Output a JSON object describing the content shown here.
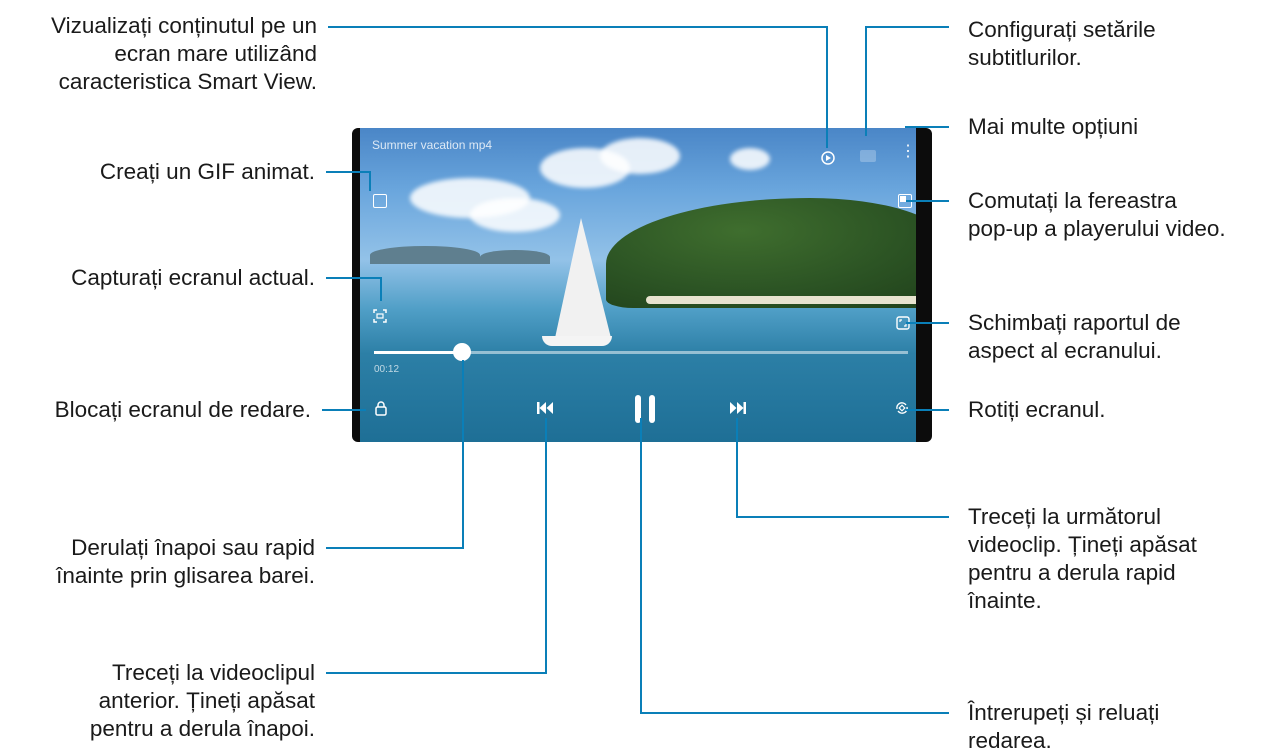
{
  "video": {
    "title": "Summer vacation mp4",
    "timecode": "00:12"
  },
  "playback": {
    "progress": 0.18
  },
  "callouts": {
    "smart_view": "Vizualizați conținutul pe un\necran mare utilizând\ncaracteristica Smart View.",
    "subtitles": "Configurați setările\nsubtitlurilor.",
    "more_options": "Mai multe opțiuni",
    "gif": "Creați un GIF animat.",
    "popup": "Comutați la fereastra\npop-up a playerului video.",
    "capture": "Capturați ecranul actual.",
    "aspect": "Schimbați raportul de\naspect al ecranului.",
    "lock": "Blocați ecranul de redare.",
    "rotate": "Rotiți ecranul.",
    "seek": "Derulați înapoi sau rapid\nînainte prin glisarea barei.",
    "next": "Treceți la următorul\nvideoclip. Țineți apăsat\npentru a derula rapid\nînainte.",
    "previous": "Treceți la videoclipul\nanterior. Țineți apăsat\npentru a derula înapoi.",
    "pause": "Întrerupeți și reluați\nredarea."
  },
  "icons": {
    "smart_view": "smart-view-icon",
    "subtitles": "subtitles-icon",
    "more": "more-vertical-icon",
    "gif": "gif-icon",
    "popup": "popup-player-icon",
    "capture": "capture-icon",
    "aspect": "aspect-ratio-icon",
    "lock": "lock-icon",
    "rotate": "rotate-icon",
    "previous": "skip-previous-icon",
    "pause": "pause-icon",
    "next": "skip-next-icon"
  },
  "colors": {
    "leader_line": "#0a7fb8"
  }
}
